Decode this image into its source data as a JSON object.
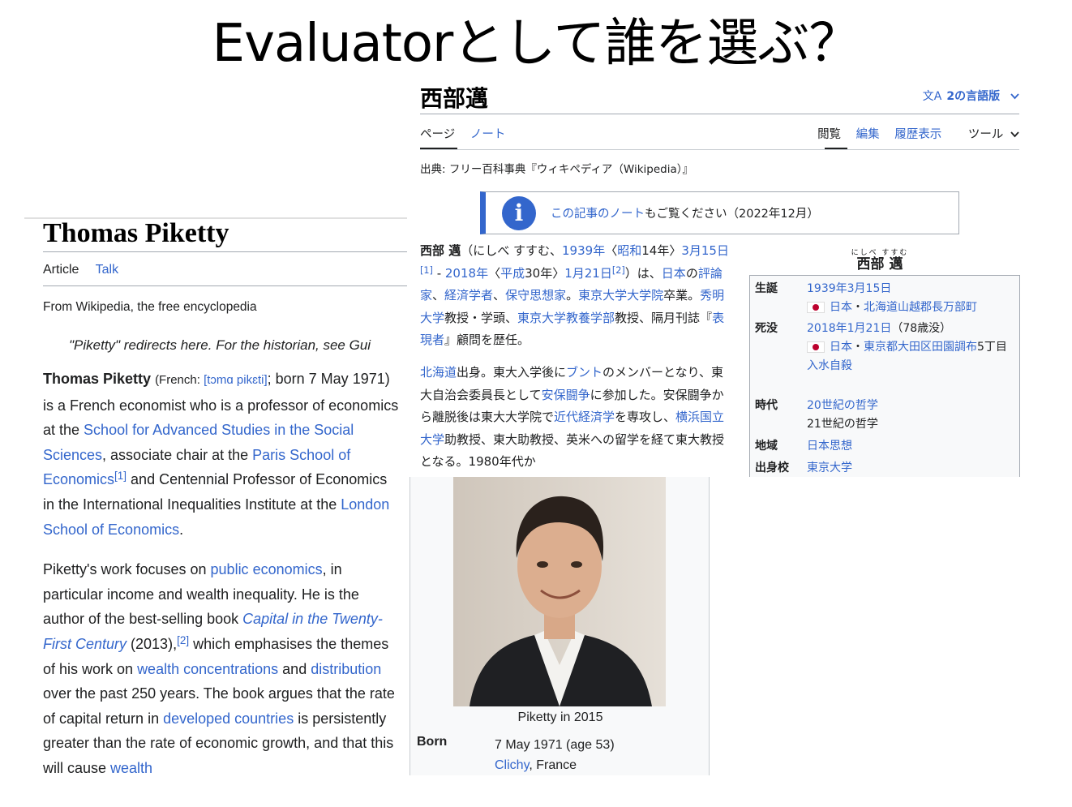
{
  "slide": {
    "title": "Evaluatorとして誰を選ぶ？"
  },
  "en_article": {
    "title": "Thomas Piketty",
    "tabs": [
      "Article",
      "Talk"
    ],
    "from": "From Wikipedia, the free encyclopedia",
    "hatnote": "\"Piketty\" redirects here. For the historian, see Gui",
    "p1": {
      "name": "Thomas Piketty",
      "pron_prefix": "(French: ",
      "ipa": "[tɔmɑ pikɛti]",
      "after_ipa": "; born 7 May 1971) is a French economist who is a professor of economics at the ",
      "link1": "School for Advanced Studies in the Social Sciences",
      "mid1": ", associate chair at the ",
      "link2": "Paris School of Economics",
      "ref1": "[1]",
      "mid2": " and Centennial Professor of Economics in the International Inequalities Institute at the ",
      "link3": "London School of Economics",
      "end": "."
    },
    "p2": {
      "t1": "Piketty's work focuses on ",
      "link1": "public economics",
      "t2": ", in particular income and wealth inequality. He is the author of the best-selling book ",
      "book": "Capital in the Twenty-First Century",
      "t3": " (2013),",
      "ref2": "[2]",
      "t4": " which emphasises the themes of his work on ",
      "link2": "wealth concentrations",
      "t5": " and ",
      "link3": "distribution",
      "t6": " over the past 250 years. The book argues that the rate of capital return in ",
      "link4": "developed countries",
      "t7": " is persistently greater than the rate of economic growth, and that this will cause ",
      "link5": "wealth"
    }
  },
  "en_infobox": {
    "caption": "Piketty in 2015",
    "born_label": "Born",
    "born_value": "7 May 1971 (age 53)",
    "born_place_link": "Clichy",
    "born_place_rest": ", France"
  },
  "ja_article": {
    "title": "西部邁",
    "lang_icon": "文A",
    "languages": "2の言語版",
    "left_tabs": [
      "ページ",
      "ノート"
    ],
    "right_tabs": [
      "閲覧",
      "編集",
      "履歴表示",
      "ツール"
    ],
    "source": "出典: フリー百科事典『ウィキペディア（Wikipedia）』",
    "notice_link": "この記事のノート",
    "notice_rest": "もご覧ください（2022年12月）",
    "p1": {
      "name": "西部 邁",
      "t1": "（にしべ すすむ、",
      "l1": "1939年",
      "t2": "〈",
      "l2": "昭和",
      "t3": "14年〉",
      "l3": "3月15日",
      "ref1": "[1]",
      "t4": " - ",
      "l4": "2018年",
      "t5": "〈",
      "l5": "平成",
      "t6": "30年〉",
      "l6": "1月21日",
      "ref2": "[2]",
      "t7": "）は、",
      "l7": "日本",
      "t8": "の",
      "l8": "評論家",
      "t9": "、",
      "l9": "経済学者",
      "t10": "、",
      "l10": "保守思想家",
      "t11": "。",
      "l11": "東京大学大学院",
      "t12": "卒業。",
      "l12": "秀明大学",
      "t13": "教授・学頭、",
      "l13": "東京大学教養学部",
      "t14": "教授、隔月刊誌『",
      "l14": "表現者",
      "t15": "』顧問を歴任。"
    },
    "p2": {
      "l1": "北海道",
      "t1": "出身。東大入学後に",
      "l2": "ブント",
      "t2": "のメンバーとなり、東大自治会委員長として",
      "l3": "安保闘争",
      "t3": "に参加した。安保闘争から離脱後は東大大学院で",
      "l4": "近代経済学",
      "t4": "を専攻し、",
      "l5": "横浜国立大学",
      "t5": "助教授、東大助教授、英米への留学を経て東大教授となる。1980年代か"
    }
  },
  "ja_infobox": {
    "ruby": "にしべ すすむ",
    "name": "西部 邁",
    "rows": [
      {
        "label": "生誕",
        "lines": [
          "1939年3月15日"
        ],
        "flag_text": "日本",
        "flag_sep": "・",
        "flag_link": "北海道山越郡長万部町"
      },
      {
        "label": "死没",
        "line1_link": "2018年1月21日",
        "line1_rest": "（78歳没）",
        "flag_text": "日本",
        "flag_sep": "・",
        "flag_link": "東京都大田区田園調布",
        "flag_after": "5丁目",
        "cause": "入水自殺"
      },
      {
        "label": "時代",
        "l1": "20世紀の哲学",
        "l2": "21世紀の哲学"
      },
      {
        "label": "地域",
        "l1": "日本思想"
      },
      {
        "label": "出身校",
        "l1": "東京大学"
      }
    ]
  },
  "colors": {
    "link": "#3366cc",
    "text": "#202122",
    "infobox_bg": "#f8f9fa",
    "notice_bar": "#3366cc",
    "flag_red": "#bc002d"
  }
}
